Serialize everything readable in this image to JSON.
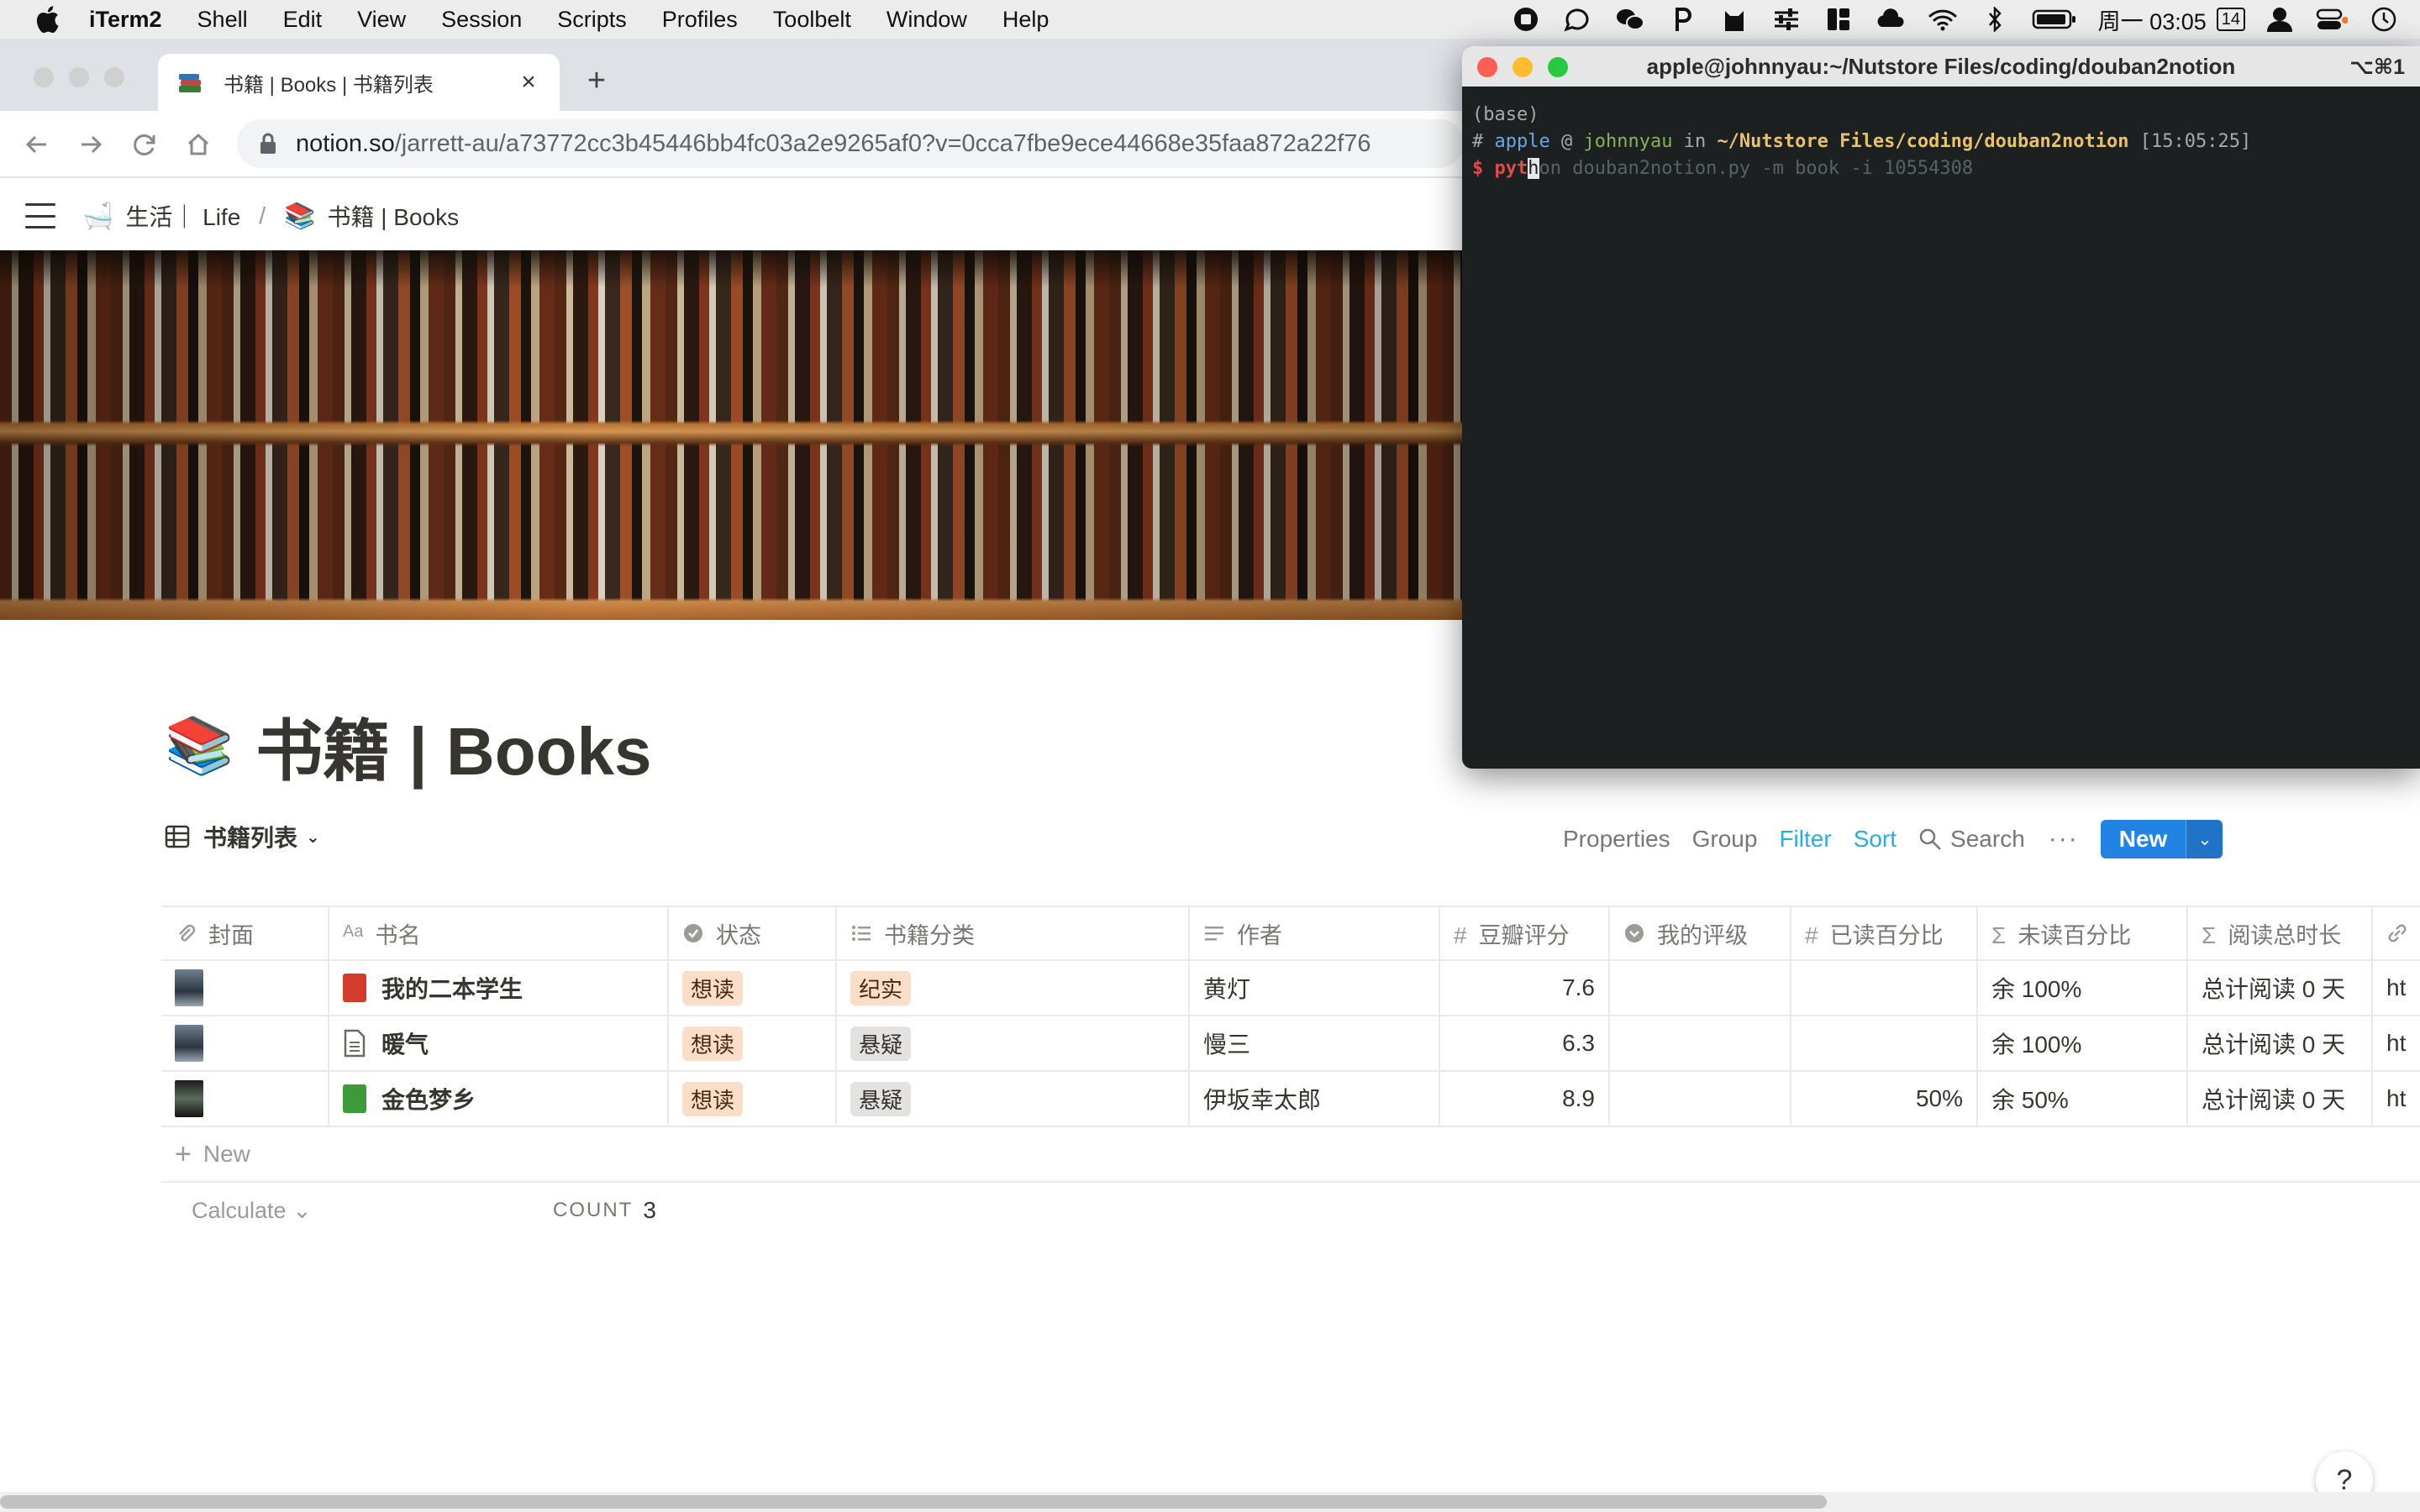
{
  "menubar": {
    "app": "iTerm2",
    "items": [
      "Shell",
      "Edit",
      "View",
      "Session",
      "Scripts",
      "Profiles",
      "Toolbelt",
      "Window",
      "Help"
    ],
    "clock": "周一 03:05",
    "date_badge": "14"
  },
  "browser": {
    "tab_title": "书籍 | Books | 书籍列表",
    "url_host": "notion.so",
    "url_path": "/jarrett-au/a73772cc3b45446bb4fc03a2e9265af0?v=0cca7fbe9ece44668e35faa872a22f76"
  },
  "notion": {
    "breadcrumb": [
      {
        "emoji": "🛁",
        "label": "生活｜ Life"
      },
      {
        "emoji": "📚",
        "label": "书籍 | Books"
      }
    ],
    "page_emoji": "📚",
    "page_title": "书籍 | Books",
    "view_name": "书籍列表",
    "actions": {
      "properties": "Properties",
      "group": "Group",
      "filter": "Filter",
      "sort": "Sort",
      "search": "Search",
      "more": "···",
      "new": "New"
    },
    "columns": [
      "封面",
      "书名",
      "状态",
      "书籍分类",
      "作者",
      "豆瓣评分",
      "我的评级",
      "已读百分比",
      "未读百分比",
      "阅读总时长",
      ""
    ],
    "rows": [
      {
        "title": "我的二本学生",
        "icon_color": "#d33b2c",
        "status": "想读",
        "category": "纪实",
        "category_style": "orange",
        "author": "黄灯",
        "rating": "7.6",
        "my_rating": "",
        "read_pct": "",
        "unread_pct": "余 100%",
        "total_time": "总计阅读 0 天",
        "link": "ht"
      },
      {
        "title": "暖气",
        "icon_color": "doc",
        "status": "想读",
        "category": "悬疑",
        "category_style": "gray",
        "author": "慢三",
        "rating": "6.3",
        "my_rating": "",
        "read_pct": "",
        "unread_pct": "余 100%",
        "total_time": "总计阅读 0 天",
        "link": "ht"
      },
      {
        "title": "金色梦乡",
        "icon_color": "#3d9a3a",
        "status": "想读",
        "category": "悬疑",
        "category_style": "gray",
        "author": "伊坂幸太郎",
        "rating": "8.9",
        "my_rating": "",
        "read_pct": "50%",
        "unread_pct": "余 50%",
        "total_time": "总计阅读 0 天",
        "link": "ht"
      }
    ],
    "new_row": "New",
    "calculate": "Calculate",
    "count_label": "COUNT",
    "count_value": "3",
    "help": "?"
  },
  "iterm": {
    "title": "apple@johnnyau:~/Nutstore Files/coding/douban2notion",
    "shortcut": "⌥⌘1",
    "line1": "(base)",
    "user": "apple",
    "host": "johnnyau",
    "path": "~/Nutstore Files/coding/douban2notion",
    "time": "[15:05:25]",
    "typed": "pyt",
    "cursor_char": "h",
    "suggestion": "on douban2notion.py -m book -i 10554308"
  }
}
